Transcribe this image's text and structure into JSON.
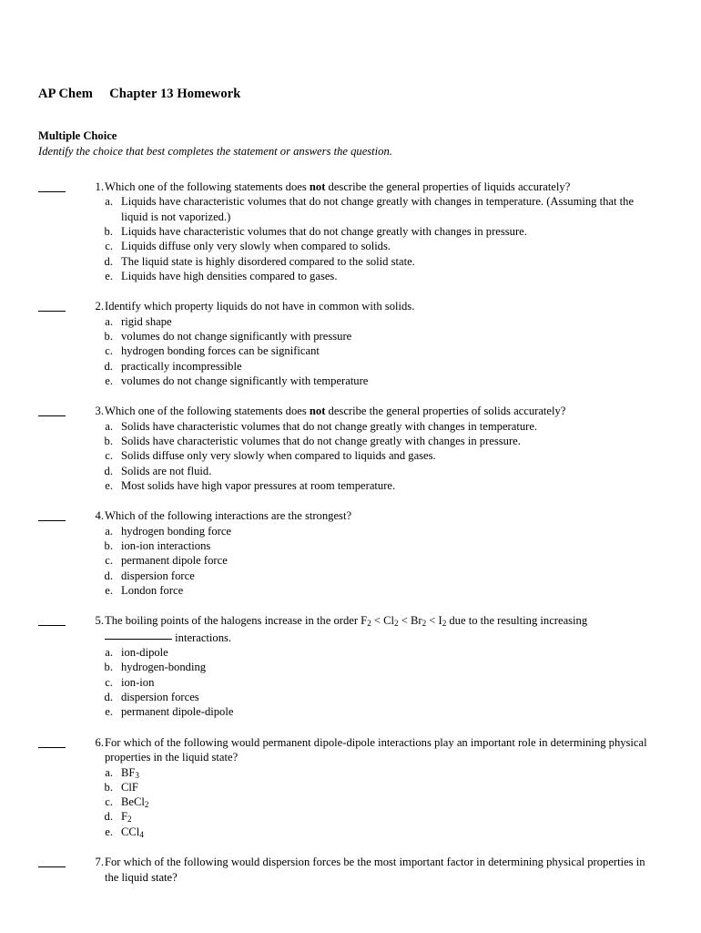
{
  "document": {
    "title": "AP Chem  Chapter 13 Homework",
    "section_heading": "Multiple Choice",
    "section_instruction": "Identify the choice that best completes the statement or answers the question."
  },
  "questions": [
    {
      "number": "1.",
      "text_before_bold": "Which one of the following statements does ",
      "bold_word": "not",
      "text_after_bold": " describe the general properties of liquids accurately?",
      "options": [
        {
          "letter": "a.",
          "text": "Liquids have characteristic volumes that do not change greatly with changes in temperature. (Assuming that the liquid is not vaporized.)"
        },
        {
          "letter": "b.",
          "text": "Liquids have characteristic volumes that do not change greatly with changes in pressure."
        },
        {
          "letter": "c.",
          "text": "Liquids diffuse only very slowly when compared to solids."
        },
        {
          "letter": "d.",
          "text": "The liquid state is highly disordered compared to the solid state."
        },
        {
          "letter": "e.",
          "text": "Liquids have high densities compared to gases."
        }
      ]
    },
    {
      "number": "2.",
      "text_before_bold": "Identify which property liquids do not have in common with solids.",
      "bold_word": "",
      "text_after_bold": "",
      "options": [
        {
          "letter": "a.",
          "text": "rigid shape"
        },
        {
          "letter": "b.",
          "text": "volumes do not change significantly with pressure"
        },
        {
          "letter": "c.",
          "text": "hydrogen bonding forces can be significant"
        },
        {
          "letter": "d.",
          "text": "practically incompressible"
        },
        {
          "letter": "e.",
          "text": "volumes do not change significantly with temperature"
        }
      ]
    },
    {
      "number": "3.",
      "text_before_bold": "Which one of the following statements does ",
      "bold_word": "not",
      "text_after_bold": " describe the general properties of solids accurately?",
      "options": [
        {
          "letter": "a.",
          "text": "Solids have characteristic volumes that do not change greatly with changes in temperature."
        },
        {
          "letter": "b.",
          "text": "Solids have characteristic volumes that do not change greatly with changes in pressure."
        },
        {
          "letter": "c.",
          "text": "Solids diffuse only very slowly when compared to liquids and gases."
        },
        {
          "letter": "d.",
          "text": "Solids are not fluid."
        },
        {
          "letter": "e.",
          "text": "Most solids have high vapor pressures at room temperature."
        }
      ]
    },
    {
      "number": "4.",
      "text_before_bold": "Which of the following interactions are the strongest?",
      "bold_word": "",
      "text_after_bold": "",
      "options": [
        {
          "letter": "a.",
          "text": "hydrogen bonding force"
        },
        {
          "letter": "b.",
          "text": "ion-ion interactions"
        },
        {
          "letter": "c.",
          "text": "permanent dipole force"
        },
        {
          "letter": "d.",
          "text": "dispersion force"
        },
        {
          "letter": "e.",
          "text": "London force"
        }
      ]
    },
    {
      "number": "5.",
      "rich_html": "The boiling points of the halogens increase in the order F<sub>2</sub> &lt; Cl<sub>2</sub> &lt; Br<sub>2</sub> &lt; I<sub>2</sub> due to the resulting increasing <span class=\"fill-blank\"></span> interactions.",
      "options": [
        {
          "letter": "a.",
          "text": "ion-dipole"
        },
        {
          "letter": "b.",
          "text": "hydrogen-bonding"
        },
        {
          "letter": "c.",
          "text": "ion-ion"
        },
        {
          "letter": "d.",
          "text": "dispersion forces"
        },
        {
          "letter": "e.",
          "text": "permanent dipole-dipole"
        }
      ]
    },
    {
      "number": "6.",
      "text_before_bold": "For which of the following would permanent dipole-dipole interactions play an important role in determining physical properties in the liquid state?",
      "bold_word": "",
      "text_after_bold": "",
      "options": [
        {
          "letter": "a.",
          "html": "BF<sub>3</sub>"
        },
        {
          "letter": "b.",
          "html": "ClF"
        },
        {
          "letter": "c.",
          "html": "BeCl<sub>2</sub>"
        },
        {
          "letter": "d.",
          "html": "F<sub>2</sub>"
        },
        {
          "letter": "e.",
          "html": "CCl<sub>4</sub>"
        }
      ]
    },
    {
      "number": "7.",
      "text_before_bold": "For which of the following would dispersion forces be the most important factor in determining physical properties in the liquid state?",
      "bold_word": "",
      "text_after_bold": "",
      "options": []
    }
  ]
}
